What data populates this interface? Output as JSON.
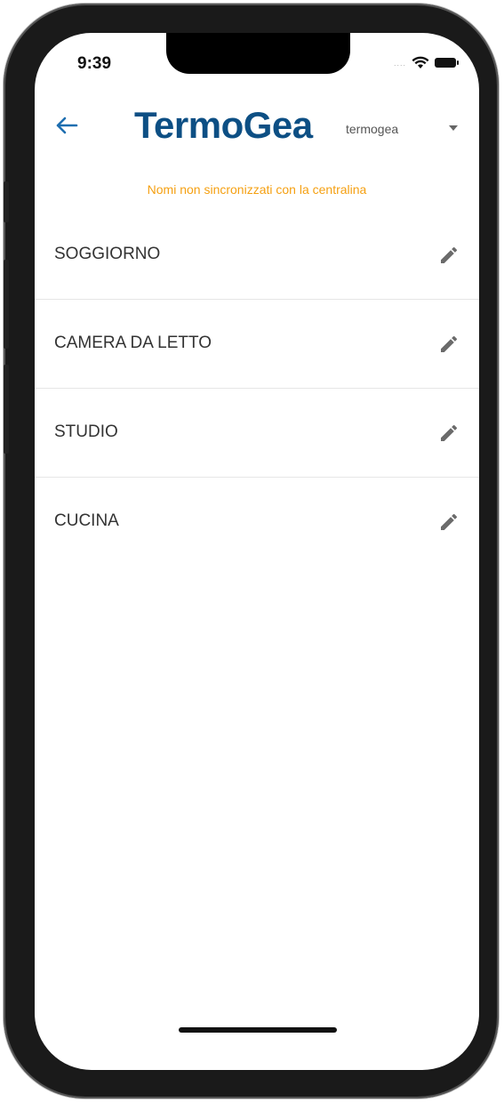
{
  "status_bar": {
    "time": "9:39",
    "signal": "....",
    "icons": [
      "wifi-icon",
      "battery-icon"
    ]
  },
  "header": {
    "back_icon": "arrow-left-icon",
    "logo_text": "TermoGea",
    "account": "termogea",
    "dropdown_icon": "caret-down-icon"
  },
  "sync_warning": "Nomi non sincronizzati con la centralina",
  "rooms": [
    {
      "name": "SOGGIORNO",
      "edit_icon": "pencil-icon"
    },
    {
      "name": "CAMERA DA LETTO",
      "edit_icon": "pencil-icon"
    },
    {
      "name": "STUDIO",
      "edit_icon": "pencil-icon"
    },
    {
      "name": "CUCINA",
      "edit_icon": "pencil-icon"
    }
  ],
  "colors": {
    "brand": "#0d4f84",
    "back_arrow": "#1f6fb0",
    "warning": "#f5a012",
    "pencil": "#6b6b6b"
  }
}
